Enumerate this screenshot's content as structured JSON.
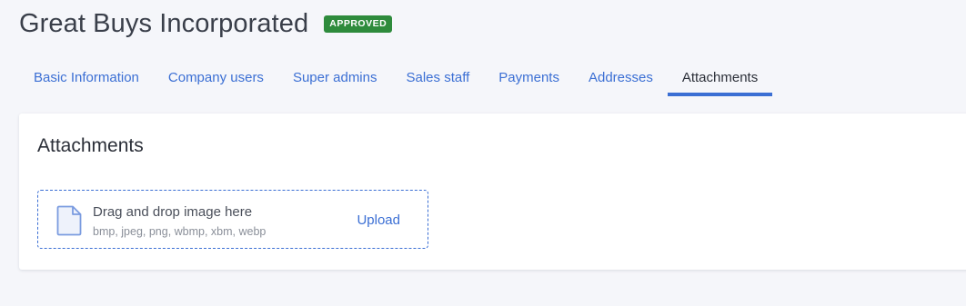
{
  "header": {
    "company_name": "Great Buys Incorporated",
    "status_badge": "APPROVED"
  },
  "tabs": [
    {
      "label": "Basic Information",
      "active": false
    },
    {
      "label": "Company users",
      "active": false
    },
    {
      "label": "Super admins",
      "active": false
    },
    {
      "label": "Sales staff",
      "active": false
    },
    {
      "label": "Payments",
      "active": false
    },
    {
      "label": "Addresses",
      "active": false
    },
    {
      "label": "Attachments",
      "active": true
    }
  ],
  "attachments": {
    "title": "Attachments",
    "dropzone": {
      "icon": "file-icon",
      "title": "Drag and drop image here",
      "formats": "bmp, jpeg, png, wbmp, xbm, webp",
      "upload_label": "Upload"
    }
  },
  "colors": {
    "accent": "#3b6fd4",
    "badge_background": "#2e8b3c",
    "page_background": "#f5f6fa"
  }
}
